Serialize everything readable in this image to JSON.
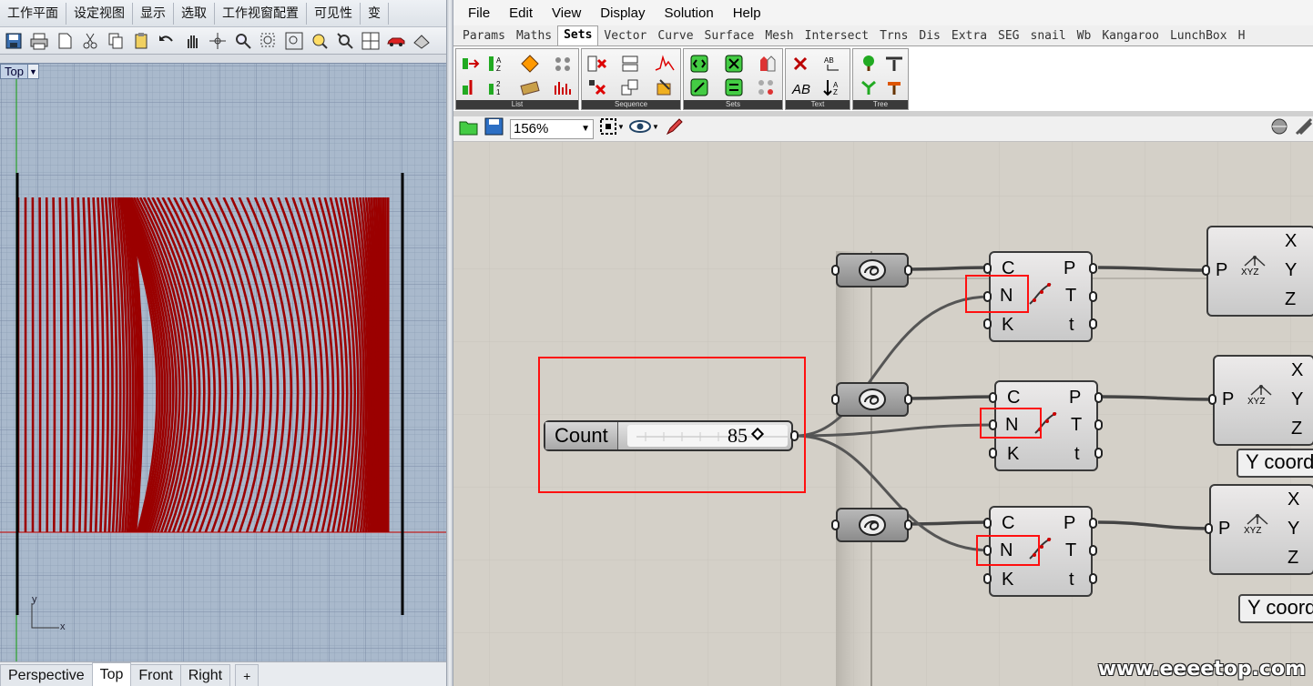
{
  "rhino": {
    "tabs": [
      "工作平面",
      "设定视图",
      "显示",
      "选取",
      "工作视窗配置",
      "可见性",
      "变"
    ],
    "viewport_label": "Top",
    "axis_y": "y",
    "axis_x": "x",
    "viewport_tabs": [
      "Perspective",
      "Top",
      "Front",
      "Right"
    ],
    "active_viewport_tab": "Top",
    "add_tab_glyph": "+",
    "curve_color": "#9b0000"
  },
  "gh": {
    "menu": [
      "File",
      "Edit",
      "View",
      "Display",
      "Solution",
      "Help"
    ],
    "tabs": [
      "Params",
      "Maths",
      "Sets",
      "Vector",
      "Curve",
      "Surface",
      "Mesh",
      "Intersect",
      "Trns",
      "Dis",
      "Extra",
      "SEG",
      "snail",
      "Wb",
      "Kangaroo",
      "LunchBox",
      "H"
    ],
    "active_tab": "Sets",
    "ribbon_groups": [
      "List",
      "Sequence",
      "Sets",
      "Text",
      "Tree"
    ],
    "zoom": "156%",
    "slider": {
      "label": "Count",
      "value": "85"
    },
    "divide": {
      "inputs": [
        "C",
        "N",
        "K"
      ],
      "outputs": [
        "P",
        "T",
        "t"
      ]
    },
    "deconstruct": {
      "input": "P",
      "outputs": [
        "X",
        "Y",
        "Z"
      ],
      "icon_text": "XYZ"
    },
    "panels": [
      "Y coord",
      "Y coord"
    ],
    "highlight_color": "#ff1010"
  },
  "watermark": "www.eeeetop.com"
}
